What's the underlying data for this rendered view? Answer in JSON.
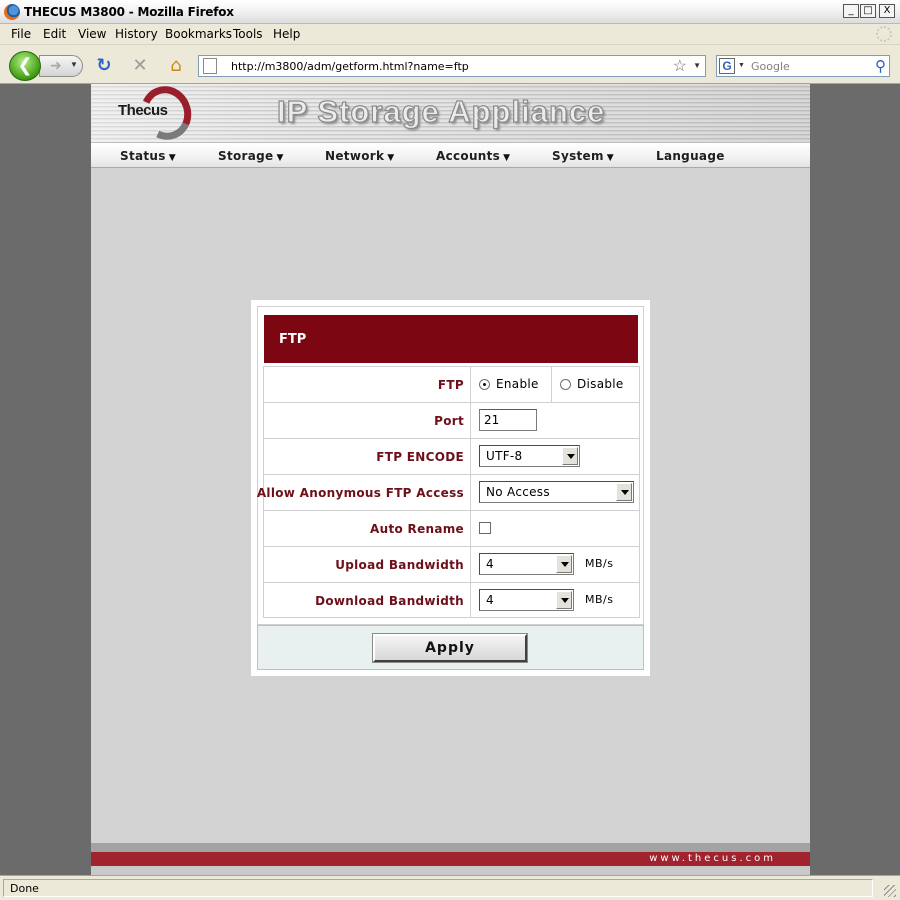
{
  "window": {
    "title": "THECUS M3800 - Mozilla Firefox",
    "controls": {
      "minimize": "_",
      "maximize": "□",
      "close": "X"
    }
  },
  "menu": {
    "items": [
      "File",
      "Edit",
      "View",
      "History",
      "Bookmarks",
      "Tools",
      "Help"
    ]
  },
  "navigation": {
    "back_icon": "back-arrow-icon",
    "forward_icon": "forward-arrow-icon",
    "url": "http://m3800/adm/getform.html?name=ftp",
    "search_placeholder": "Google"
  },
  "site": {
    "logo_text": "Thecus",
    "banner_title": "IP Storage Appliance",
    "nav": [
      "Status",
      "Storage",
      "Network",
      "Accounts",
      "System",
      "Language"
    ],
    "footer_url": "www.thecus.com",
    "colors": {
      "header_red": "#7c0611",
      "label_red": "#6e0f19",
      "footer_red": "#a0232e"
    }
  },
  "ftp_form": {
    "title": "FTP",
    "rows": {
      "ftp": {
        "label": "FTP",
        "options": [
          "Enable",
          "Disable"
        ],
        "selected": "Enable"
      },
      "port": {
        "label": "Port",
        "value": "21"
      },
      "encode": {
        "label": "FTP ENCODE",
        "value": "UTF-8"
      },
      "anonymous": {
        "label": "Allow Anonymous FTP Access",
        "value": "No Access"
      },
      "auto_rename": {
        "label": "Auto Rename",
        "checked": false
      },
      "upload": {
        "label": "Upload Bandwidth",
        "value": "4",
        "unit": "MB/s"
      },
      "download": {
        "label": "Download Bandwidth",
        "value": "4",
        "unit": "MB/s"
      }
    },
    "apply_label": "Apply"
  },
  "status": {
    "text": "Done"
  }
}
